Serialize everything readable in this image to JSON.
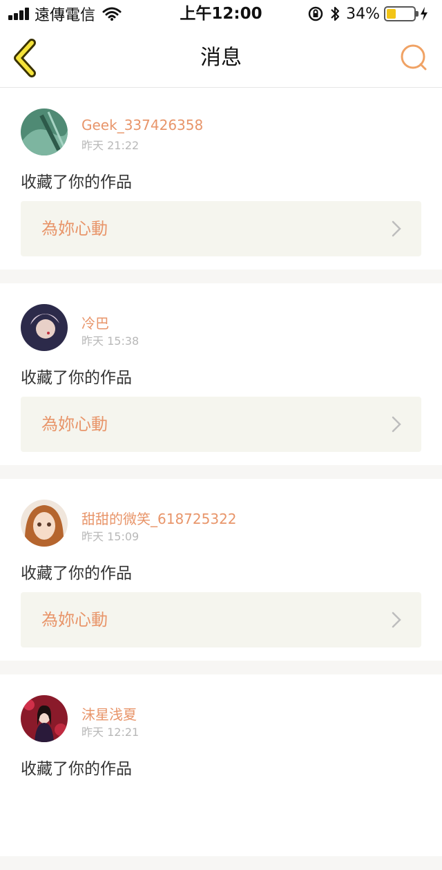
{
  "status_bar": {
    "carrier": "遠傳電信",
    "time": "上午12:00",
    "battery_percent": "34%",
    "battery_level": 0.34
  },
  "nav": {
    "title": "消息",
    "accent_color": "#f0a264"
  },
  "messages": [
    {
      "username": "Geek_337426358",
      "time": "昨天 21:22",
      "action": "收藏了你的作品",
      "work_title": "為妳心動"
    },
    {
      "username": "冷巴",
      "time": "昨天 15:38",
      "action": "收藏了你的作品",
      "work_title": "為妳心動"
    },
    {
      "username": "甜甜的微笑_618725322",
      "time": "昨天 15:09",
      "action": "收藏了你的作品",
      "work_title": "為妳心動"
    },
    {
      "username": "沫星浅夏",
      "time": "昨天 12:21",
      "action": "收藏了你的作品",
      "work_title": ""
    }
  ]
}
